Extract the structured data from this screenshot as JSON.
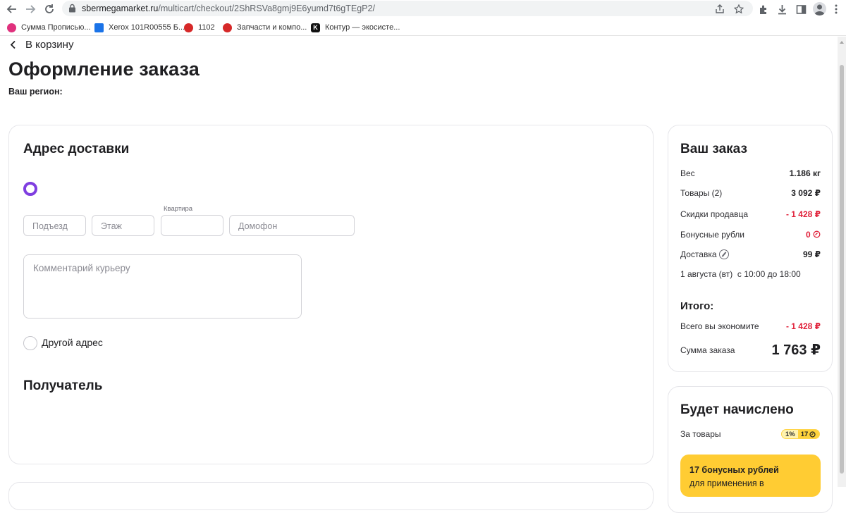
{
  "browser": {
    "url_host": "sbermegamarket.ru",
    "url_path": "/multicart/checkout/2ShRSVa8gmj9E6yumd7t6gTEgP2/"
  },
  "bookmarks": [
    {
      "label": "Сумма Прописью...",
      "icon": "bookmark-favicon",
      "color": "#e0317d"
    },
    {
      "label": "Xerox 101R00555 Б...",
      "icon": "xerox-favicon",
      "color": "#1a73e8"
    },
    {
      "label": "1102",
      "icon": "bookmark-favicon",
      "color": "#d62828"
    },
    {
      "label": "Запчасти и компо...",
      "icon": "bookmark-favicon",
      "color": "#d62828"
    },
    {
      "label": "Контур — экосисте...",
      "icon": "kontur-favicon",
      "color": "#111111"
    }
  ],
  "header": {
    "back_label": "В корзину",
    "title": "Оформление заказа",
    "region_label": "Ваш регион:"
  },
  "delivery": {
    "title": "Адрес доставки",
    "fields": {
      "entrance_placeholder": "Подъезд",
      "floor_placeholder": "Этаж",
      "apartment_label": "Квартира",
      "apartment_placeholder": "",
      "intercom_placeholder": "Домофон",
      "comment_placeholder": "Комментарий курьеру"
    },
    "other_address_label": "Другой адрес"
  },
  "recipient": {
    "title": "Получатель"
  },
  "order": {
    "title": "Ваш заказ",
    "rows": {
      "weight_label": "Вес",
      "weight_value": "1.186 кг",
      "goods_label": "Товары (2)",
      "goods_value": "3 092 ₽",
      "discount_label": "Скидки продавца",
      "discount_value": "- 1 428 ₽",
      "bonus_label": "Бонусные рубли",
      "bonus_value": "0",
      "delivery_label": "Доставка",
      "delivery_value": "99 ₽",
      "delivery_date": "1 августа (вт)  с 10:00 до 18:00"
    },
    "total_title": "Итого:",
    "savings_label": "Всего вы экономите",
    "savings_value": "- 1 428 ₽",
    "sum_label": "Сумма заказа",
    "sum_value": "1 763 ₽"
  },
  "bonus": {
    "title": "Будет начислено",
    "goods_label": "За товары",
    "badge_percent": "1%",
    "badge_amount": "17",
    "promo_line1": "17 бонусных рублей",
    "promo_line2": "для применения в"
  },
  "colors": {
    "accent_purple": "#7f3ee0",
    "discount_red": "#e0213a",
    "bonus_yellow": "#ffcc33"
  }
}
